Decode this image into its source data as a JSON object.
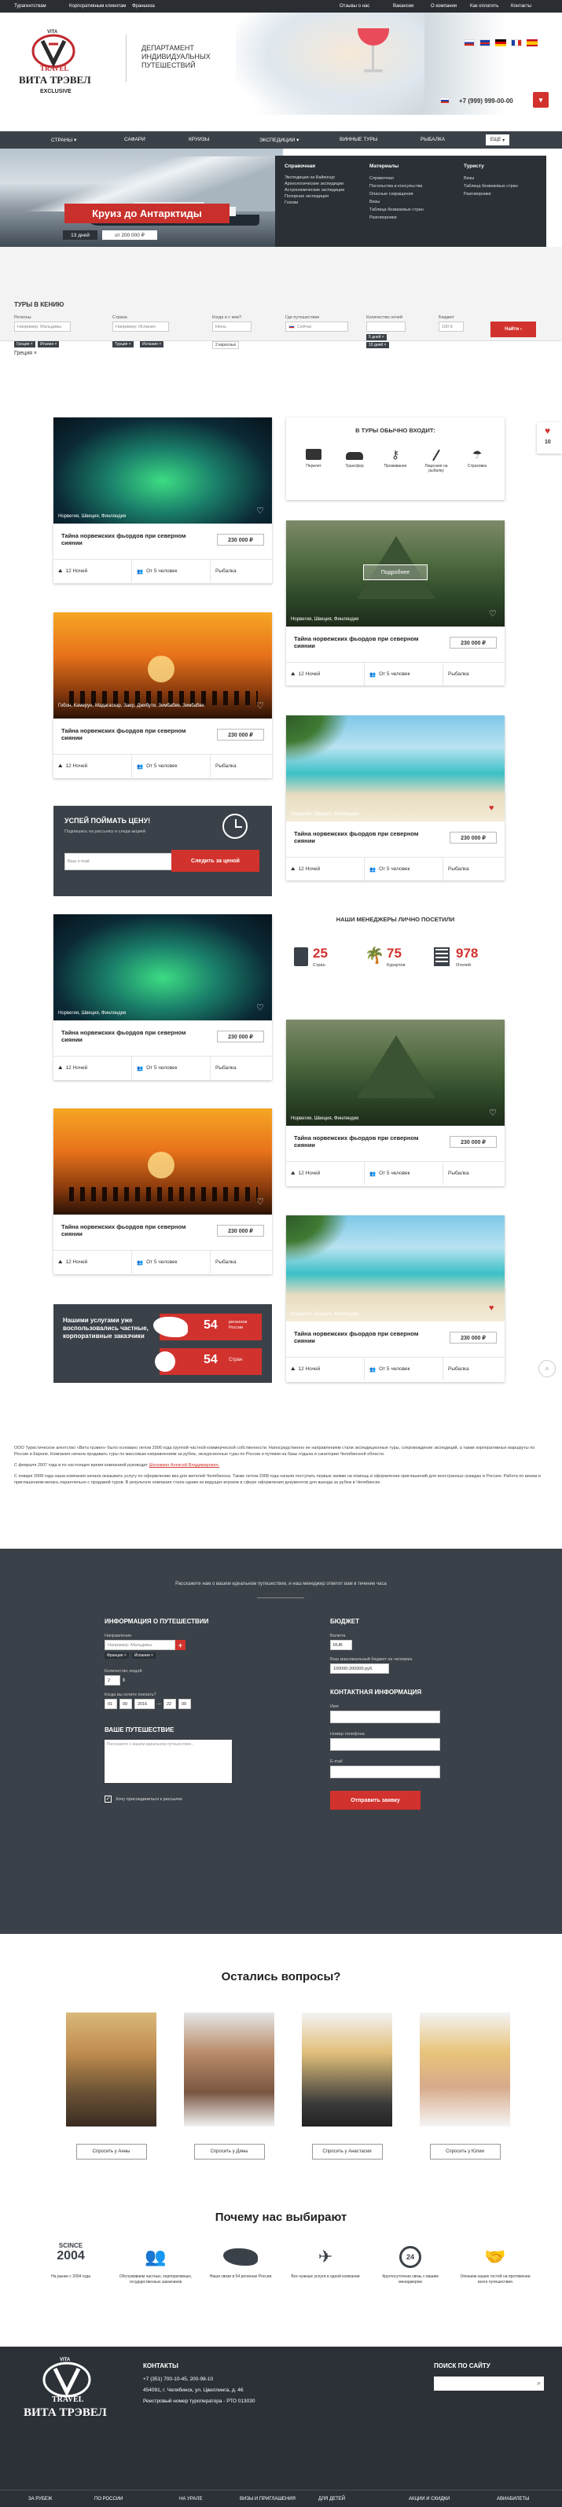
{
  "topbar": {
    "left_links": [
      "Турагентствам",
      "Корпоративным клиентам",
      "Франшиза"
    ],
    "right_links": [
      "Отзывы о нас",
      "Вакансии",
      "О компании",
      "Как оплатить",
      "Контакты"
    ]
  },
  "header": {
    "logo_small": "VITA",
    "logo_mid": "TRAVEL",
    "logo_big": "ВИТА ТРЭВЕЛ",
    "exclusive": "EXCLUSIVE",
    "department": "ДЕПАРТАМЕНТ\nИНДИВИДУАЛЬНЫХ\nПУТЕШЕСТВИЙ",
    "phone": "+7 (999) 999-00-00"
  },
  "nav": {
    "items": [
      "СТРАНЫ",
      "САФАРИ",
      "КРУИЗЫ",
      "ЭКСПЕДИЦИИ",
      "ВИННЫЕ ТУРЫ",
      "РЫБАЛКА"
    ],
    "more": "ЕЩЕ"
  },
  "megamenu": {
    "col1_title": "Справочная",
    "col1": [
      "Экспедиции на Байконур",
      "Археологические экспедиции",
      "Астрономические экспедиции",
      "Полярная экспедиция",
      "Гохови"
    ],
    "col2_title": "Материалы",
    "col2": [
      "Справочная",
      "Посольства и консульства",
      "Опасные сокращения",
      "Визы",
      "Таблица безвизовых стран",
      "Разговорники"
    ],
    "col3_title": "Туристу",
    "col3": [
      "Визы",
      "Таблица безвизовых стран",
      "Разговорники"
    ]
  },
  "hero": {
    "title": "Круиз до Антарктиды",
    "days": "13 дней",
    "price": "от 200 000 ₽"
  },
  "search": {
    "title": "ТУРЫ В КЕНИЮ",
    "labels": [
      "Регионы",
      "Страна",
      "Когда и с кем?",
      "Где путешествие",
      "Количество ночей",
      "Бюджет"
    ],
    "placeholders": [
      "Например: Мальдивы",
      "Например: Испания",
      "Июнь",
      "Сейчас",
      "",
      "100 К"
    ],
    "tags1": [
      "Греция ×",
      "Италия ×"
    ],
    "tags2": [
      "Турция ×",
      "Испания ×"
    ],
    "sub3": "2 взрослых",
    "tags5": [
      "5 дней ×",
      "10 дней ×"
    ],
    "button": "Найти"
  },
  "tours": {
    "caption": "Норвегия, Швеция, Финляндия",
    "caption2": "Гобон, Камерун, Мадагаскар, Заир, Джибути, Зимбабве, Зимбабве",
    "title": "Тайна норвежских фьордов при северном сиянии",
    "price": "230 000 ₽",
    "nights": "12 Ночей",
    "people": "От 5 человек",
    "activity": "Рыбалка",
    "more": "Подробнее"
  },
  "included": {
    "title": "В ТУРЫ ОБЫЧНО ВХОДИТ:",
    "items": [
      "Перелет",
      "Трансфер",
      "Проживание",
      "Лицензия на рыбалку",
      "Страховка"
    ]
  },
  "wishlist": {
    "count": "10"
  },
  "price_catch": {
    "title": "УСПЕЙ ПОЙМАТЬ ЦЕНУ!",
    "subtitle": "Подпишись на рассылку и следи акцией",
    "placeholder": "Ваш e-mail",
    "button": "Следить за ценой"
  },
  "managers": {
    "title": "НАШИ МЕНЕДЖЕРЫ ЛИЧНО ПОСЕТИЛИ",
    "stats": [
      {
        "num": "25",
        "label": "Стран"
      },
      {
        "num": "75",
        "label": "Курортов"
      },
      {
        "num": "978",
        "label": "Отелей"
      }
    ]
  },
  "corporate": {
    "title": "Нашими услугами уже воспользовались частные, корпоративные заказчики",
    "stat1_num": "54",
    "stat1_label": "регионов России",
    "stat2_num": "54",
    "stat2_label": "Стран"
  },
  "about": {
    "p1": "ООО Туристическое агентство «Вита трэвел» было основано летом 2006 года группой частной коммерческой собственности. Напосредственно ее направлением стали экспедиционные туры, сопровождение экспедиций, а также корпоративные маршруты по России и Европе. Компания начала продавать туры по массовым направлениям за рубеж, экскурсионные туры по России и путевки на базы отдыха и санатории Челябинской области.",
    "p2": "С февраля 2007 года в по настоящее время компанией руководит",
    "p2_link": "Шеловкин Алексей Владимирович.",
    "p3": "С января 2008 года наша компания начала оказывать услугу по оформлению виз для жителей Челябинска. Также летом 2008 года начали поступать первые заявки на помощь в оформлении приглашений для иностранных граждан в Россию. Работа по визам и приглашениям велась параллельно с продажей туров. В результате компания стала одним из ведущих игроков в сфере оформления документов для выезда за рубеж в Челябинске."
  },
  "form": {
    "intro": "Расскажите нам о вашем идеальном путешествии, и наш менеджер ответит вам в течение часа",
    "info_title": "ИНФОРМАЦИЯ О ПУТЕШЕСТВИИ",
    "label_direction": "Направление",
    "direction_placeholder": "Например: Мальдивы",
    "dir_tags": [
      "Франция ×",
      "Испания ×"
    ],
    "label_people": "Количество людей",
    "people_value": "2",
    "label_dates": "Когда вы хотите поехать?",
    "dates": [
      "01",
      "09",
      "2016",
      "22",
      "09"
    ],
    "journey_title": "ВАШЕ ПУТЕШЕСТВИЕ",
    "journey_placeholder": "Расскажите о вашем идеальном путешествии...",
    "agree": "Хочу присоединиться к рассылке",
    "budget_title": "БЮДЖЕТ",
    "label_currency": "Валюта",
    "currency_value": "RUB",
    "label_budget": "Ваш максимальный бюджет на человека",
    "budget_value": "100000-200000 руб.",
    "contact_title": "КОНТАКТНАЯ ИНФОРМАЦИЯ",
    "label_name": "Имя",
    "label_phone": "Номер телефона",
    "label_email": "E-mail",
    "submit": "Отправить заявку"
  },
  "questions": {
    "title": "Остались вопросы?",
    "people": [
      "Спросить у Анны",
      "Спросить у Дины",
      "Спросить у Анастасии",
      "Спросить у Юлии"
    ]
  },
  "why": {
    "title": "Почему нас выбирают",
    "since_small": "SCINCE",
    "since_year": "2004",
    "items": [
      "На рынке с 2004 года",
      "Обслуживаем частных, корпоративных, государственных заказчиков",
      "Наши связи в 54 регионах России",
      "Все нужные услуги в одной компании",
      "Круглосуточная связь с вашим менеджером",
      "Опекаем наших гостей на протяжении всего путешествия"
    ]
  },
  "footer": {
    "contacts_title": "КОНТАКТЫ",
    "phones": "+7 (351) 700-10-45, 200-98-10",
    "address": "454091, г. Челябинск, ул. Цвиллинга, д. 46",
    "registry": "Реестровый номер туроператора - РТО 013030",
    "search_title": "ПОИСК ПО САЙТУ",
    "bottom_links": [
      "ЗА РУБЕЖ",
      "ПО РОССИИ",
      "НА УРАЛЕ",
      "ВИЗЫ И ПРИГЛАШЕНИЯ",
      "ДЛЯ ДЕТЕЙ",
      "АКЦИИ И СКИДКИ",
      "АВИАБИЛЕТЫ"
    ]
  }
}
